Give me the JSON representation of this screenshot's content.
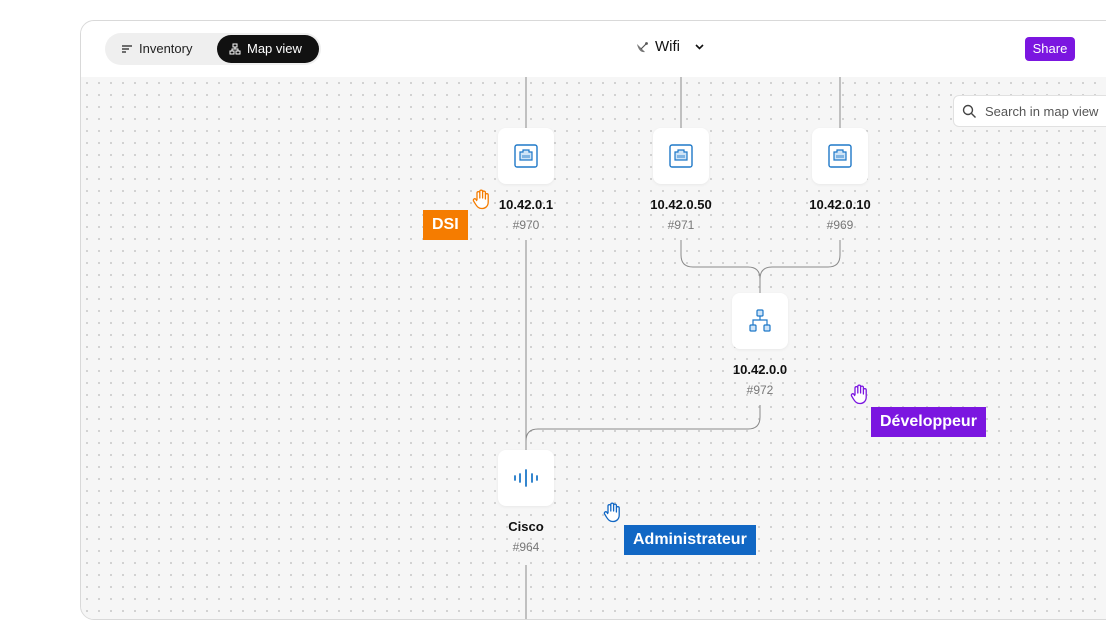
{
  "toolbar": {
    "inventory_label": "Inventory",
    "map_view_label": "Map view",
    "title": "Wifi",
    "share_label": "Share"
  },
  "search": {
    "placeholder": "Search in map view"
  },
  "nodes": {
    "n970": {
      "label": "10.42.0.1",
      "id": "#970",
      "icon": "ethernet-port-icon"
    },
    "n971": {
      "label": "10.42.0.50",
      "id": "#971",
      "icon": "ethernet-port-icon"
    },
    "n969": {
      "label": "10.42.0.10",
      "id": "#969",
      "icon": "ethernet-port-icon"
    },
    "n972": {
      "label": "10.42.0.0",
      "id": "#972",
      "icon": "network-hierarchy-icon"
    },
    "n964": {
      "label": "Cisco",
      "id": "#964",
      "icon": "cisco-logo-icon"
    }
  },
  "cursors": {
    "dsi": {
      "label": "DSI",
      "color": "#f57c00"
    },
    "developpeur": {
      "label": "Développeur",
      "color": "#7b16e0"
    },
    "administrateur": {
      "label": "Administrateur",
      "color": "#1167c4"
    }
  },
  "colors": {
    "accent": "#7b16e0",
    "icon_blue": "#1e78c8"
  }
}
